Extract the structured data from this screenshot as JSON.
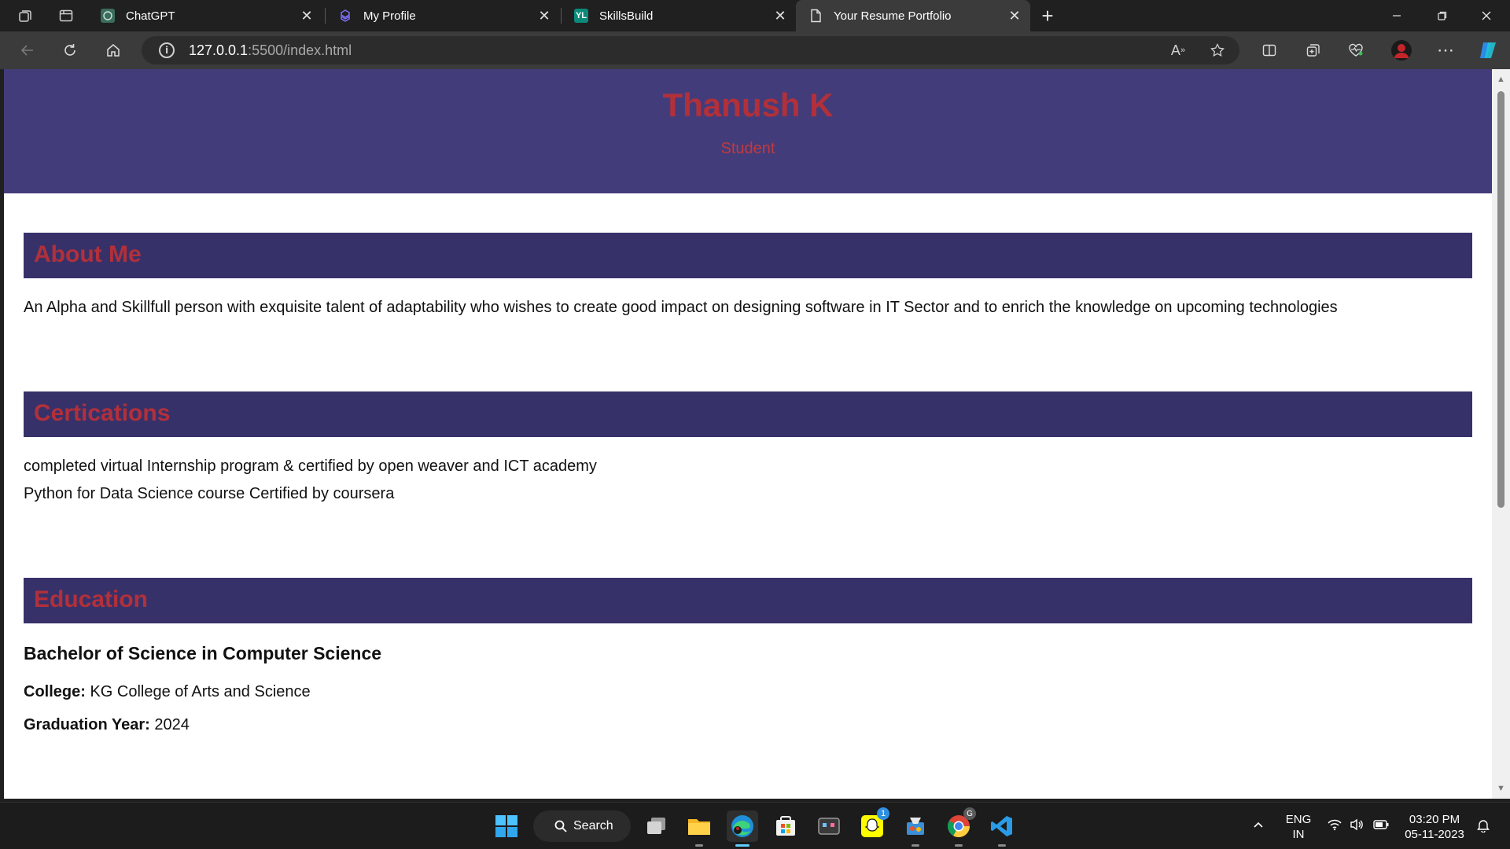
{
  "browser": {
    "tabs": [
      {
        "label": "ChatGPT",
        "favicon": "chatgpt-icon",
        "active": false
      },
      {
        "label": "My Profile",
        "favicon": "profile-site-icon",
        "active": false
      },
      {
        "label": "SkillsBuild",
        "favicon": "skillsbuild-icon",
        "active": false
      },
      {
        "label": "Your Resume Portfolio",
        "favicon": "page-icon",
        "active": true
      }
    ],
    "url_host": "127.0.0.1",
    "url_path": ":5500/index.html"
  },
  "page": {
    "name": "Thanush K",
    "role": "Student",
    "about": {
      "title": "About Me",
      "text": "An Alpha and Skillfull person with exquisite talent of adaptability who wishes to create good impact on designing software in IT Sector and to enrich the knowledge on upcoming technologies"
    },
    "certifications": {
      "title": "Certications",
      "items": [
        "completed virtual Internship program & certified by open weaver and ICT academy",
        "Python for Data Science course Certified by coursera"
      ]
    },
    "education": {
      "title": "Education",
      "degree": "Bachelor of Science in Computer Science",
      "college_label": "College:",
      "college": "KG College of Arts and Science",
      "year_label": "Graduation Year:",
      "year": "2024"
    }
  },
  "taskbar": {
    "search_label": "Search",
    "snapchat_badge": "1",
    "chrome_badge": "G",
    "lang_1": "ENG",
    "lang_2": "IN",
    "time": "03:20 PM",
    "date": "05-11-2023"
  },
  "colors": {
    "header_bg": "#433c7a",
    "section_bar_bg": "#37316a",
    "heading_red": "#b2303a"
  }
}
